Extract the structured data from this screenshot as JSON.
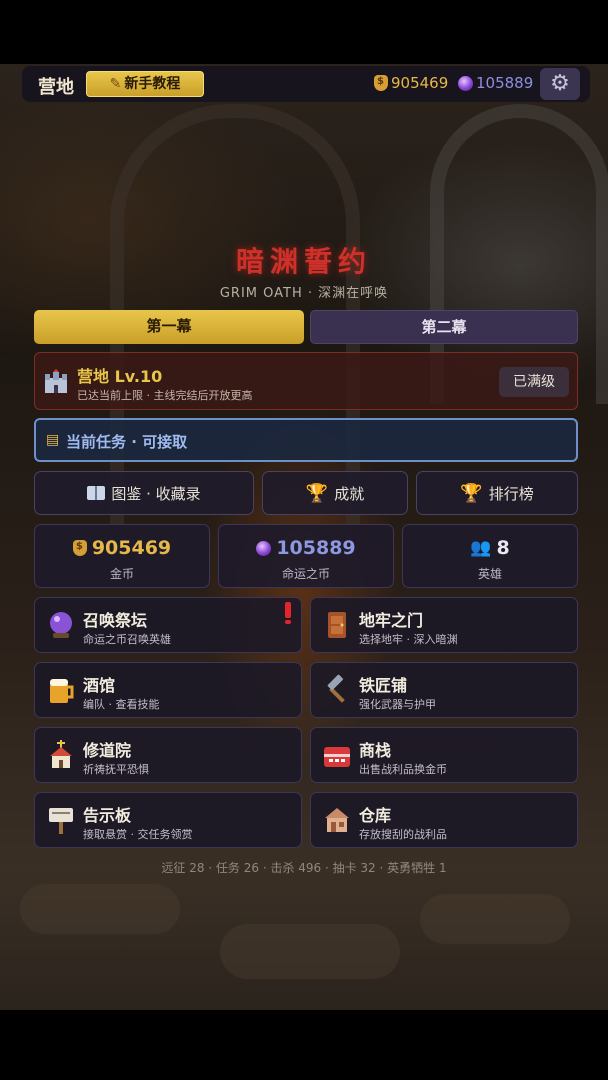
{
  "topbar": {
    "title": "营地",
    "tutorial_label": "新手教程",
    "gold": "905469",
    "fate": "105889"
  },
  "hero": {
    "title": "暗渊誓约",
    "subtitle": "GRIM OATH · 深渊在呼唤"
  },
  "acts": [
    {
      "label": "第一幕",
      "selected": true
    },
    {
      "label": "第二幕",
      "selected": false
    }
  ],
  "camp": {
    "title": "营地 Lv.10",
    "subtitle": "已达当前上限 · 主线完结后开放更高",
    "status": "已满级"
  },
  "quest": {
    "label": "当前任务 · 可接取"
  },
  "nav": [
    {
      "label": "图鉴 · 收藏录",
      "icon": "book-icon"
    },
    {
      "label": "成就",
      "icon": "trophy-icon"
    },
    {
      "label": "排行榜",
      "icon": "trophy-icon"
    }
  ],
  "stats": [
    {
      "value": "905469",
      "label": "金币",
      "icon": "coin-bag-icon"
    },
    {
      "value": "105889",
      "label": "命运之币",
      "icon": "crystal-orb-icon"
    },
    {
      "value": "8",
      "label": "英雄",
      "icon": "heroes-icon"
    }
  ],
  "locations": [
    {
      "title": "召唤祭坛",
      "subtitle": "命运之币召唤英雄",
      "icon": "crystal-ball-icon",
      "alert": true
    },
    {
      "title": "地牢之门",
      "subtitle": "选择地牢 · 深入暗渊",
      "icon": "door-icon"
    },
    {
      "title": "酒馆",
      "subtitle": "编队 · 查看技能",
      "icon": "beer-mug-icon"
    },
    {
      "title": "铁匠铺",
      "subtitle": "强化武器与护甲",
      "icon": "hammer-icon"
    },
    {
      "title": "修道院",
      "subtitle": "祈祷抚平恐惧",
      "icon": "church-icon"
    },
    {
      "title": "商栈",
      "subtitle": "出售战利品换金币",
      "icon": "shop-chest-icon"
    },
    {
      "title": "告示板",
      "subtitle": "接取悬赏 · 交任务领赏",
      "icon": "signboard-icon"
    },
    {
      "title": "仓库",
      "subtitle": "存放搜刮的战利品",
      "icon": "warehouse-icon"
    }
  ],
  "footer": "远征 28 · 任务 26 · 击杀 496 · 抽卡 32 · 英勇牺牲 1",
  "colors": {
    "accent_gold": "#e8c64a",
    "title_red": "#d0302a",
    "quest_blue": "#6f8fc8"
  }
}
